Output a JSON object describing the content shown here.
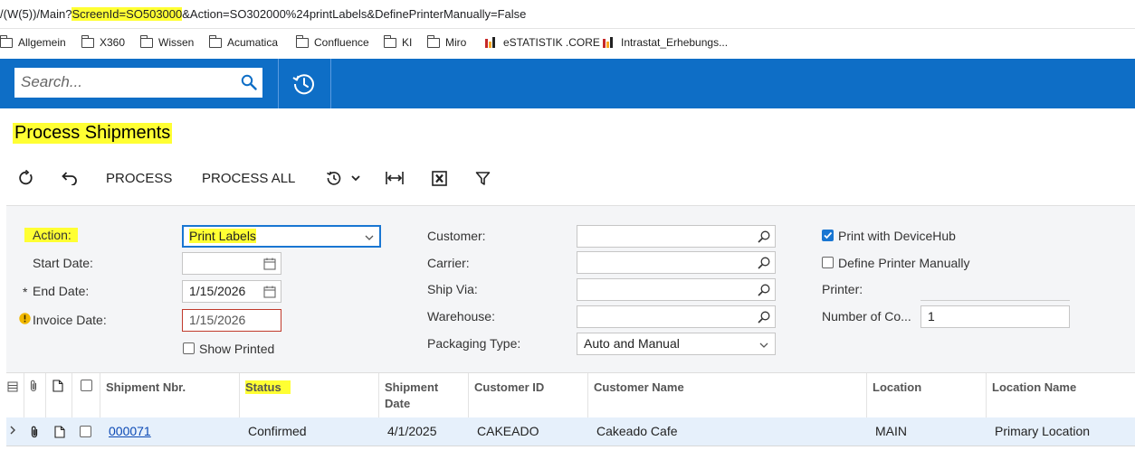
{
  "url": {
    "prefix": "/(W(5))/Main?",
    "highlight": "ScreenId=SO503000",
    "suffix": "&Action=SO302000%24printLabels&DefinePrinterManually=False"
  },
  "bookmarks": [
    "Allgemein",
    "X360",
    "Wissen",
    "Acumatica",
    "Confluence",
    "KI",
    "Miro",
    "eSTATISTIK .CORE",
    "Intrastat_Erhebungs..."
  ],
  "search": {
    "placeholder": "Search..."
  },
  "page_title": "Process Shipments",
  "toolbar": {
    "process": "PROCESS",
    "process_all": "PROCESS ALL"
  },
  "filters": {
    "action_label": "Action:",
    "action_value": "Print Labels",
    "start_date_label": "Start Date:",
    "start_date_value": "",
    "end_date_label": "End Date:",
    "end_date_required": "*",
    "end_date_value": "1/15/2026",
    "invoice_date_label": "Invoice Date:",
    "invoice_date_value": "1/15/2026",
    "show_printed_label": "Show Printed",
    "customer_label": "Customer:",
    "carrier_label": "Carrier:",
    "ship_via_label": "Ship Via:",
    "warehouse_label": "Warehouse:",
    "packaging_type_label": "Packaging Type:",
    "packaging_type_value": "Auto and Manual",
    "print_devicehub_label": "Print with DeviceHub",
    "print_devicehub_checked": true,
    "define_printer_label": "Define Printer Manually",
    "define_printer_checked": false,
    "printer_label": "Printer:",
    "num_copies_label": "Number of Co...",
    "num_copies_value": "1"
  },
  "grid": {
    "columns": {
      "shipment_nbr": "Shipment Nbr.",
      "status": "Status",
      "shipment_date": "Shipment Date",
      "customer_id": "Customer ID",
      "customer_name": "Customer Name",
      "location": "Location",
      "location_name": "Location Name"
    },
    "rows": [
      {
        "shipment_nbr": "000071",
        "status": "Confirmed",
        "shipment_date": "4/1/2025",
        "customer_id": "CAKEADO",
        "customer_name": "Cakeado Cafe",
        "location": "MAIN",
        "location_name": "Primary Location"
      }
    ]
  },
  "colors": {
    "accent": "#0e6ec6",
    "highlight": "#ffff33",
    "link": "#0b49b5",
    "error": "#c0392b",
    "row_selected": "#e6f0fb"
  }
}
